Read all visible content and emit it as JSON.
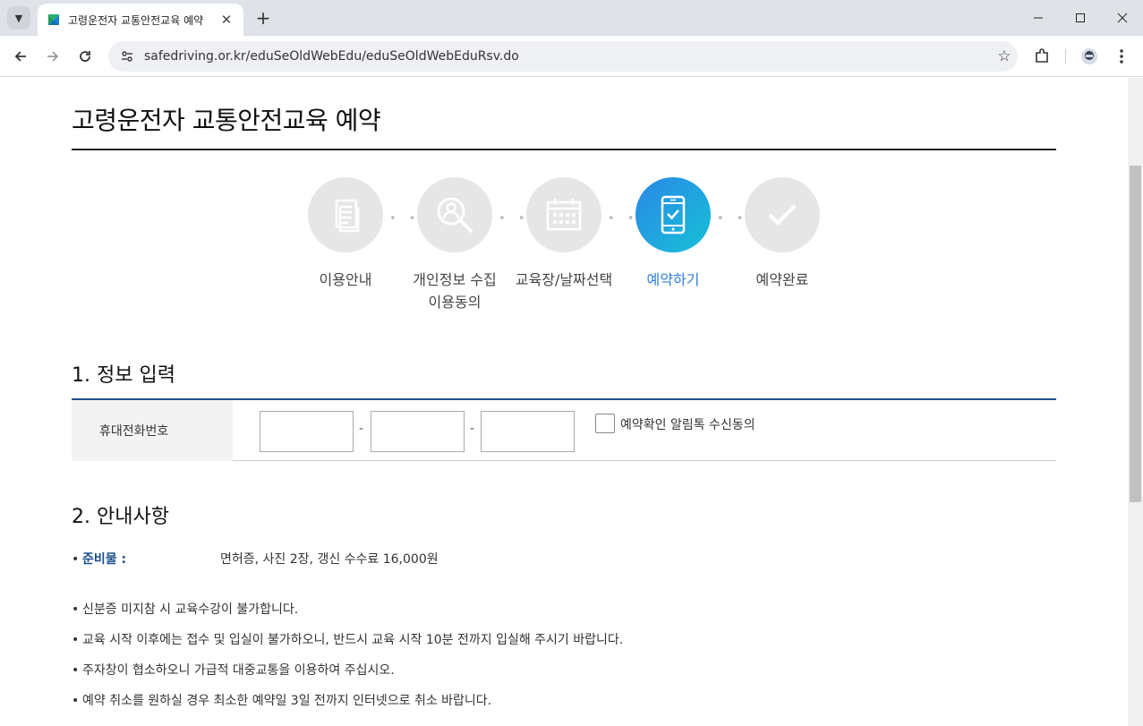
{
  "browser": {
    "tab_title": "고령운전자 교통안전교육 예약",
    "url": "safedriving.or.kr/eduSeOldWebEdu/eduSeOldWebEduRsv.do"
  },
  "page": {
    "title": "고령운전자 교통안전교육 예약"
  },
  "steps": [
    {
      "label": "이용안내",
      "icon": "document-icon",
      "active": false
    },
    {
      "label": "개인정보 수집",
      "label2": "이용동의",
      "icon": "search-person-icon",
      "active": false
    },
    {
      "label": "교육장/날짜선택",
      "icon": "calendar-icon",
      "active": false
    },
    {
      "label": "예약하기",
      "icon": "mobile-check-icon",
      "active": true
    },
    {
      "label": "예약완료",
      "icon": "check-icon",
      "active": false
    }
  ],
  "section1": {
    "title": "1. 정보 입력",
    "phone_label": "휴대전화번호",
    "phone_values": [
      "",
      "",
      ""
    ],
    "dash": "-",
    "consent_label": "예약확인 알림톡 수신동의",
    "consent_checked": false
  },
  "section2": {
    "title": "2. 안내사항",
    "prep_key": "준비물 :",
    "prep_value": "면허증, 사진 2장, 갱신 수수료 16,000원",
    "notices": [
      "신분증 미지참 시 교육수강이 불가합니다.",
      "교육 시작 이후에는 접수 및 입실이 불가하오니, 반드시 교육 시작 10분 전까지 입실해 주시기 바랍니다.",
      "주자창이 협소하오니 가급적 대중교통을 이용하여 주십시오.",
      "예약 취소를 원하실 경우 최소한 예약일 3일 전까지 인터넷으로 취소 바랍니다."
    ],
    "bullet": "•"
  },
  "colors": {
    "accent_blue": "#2f7fd8",
    "section_border": "#1c4f8f",
    "inactive_circle": "#e6e6e6"
  }
}
